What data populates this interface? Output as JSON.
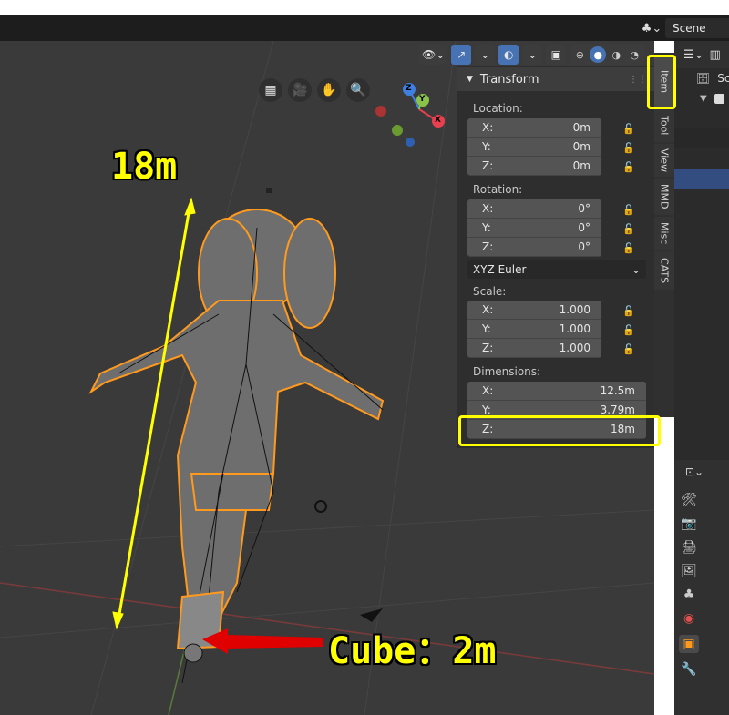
{
  "header": {
    "scene_label": "Scene"
  },
  "panel": {
    "title": "Transform",
    "location": {
      "label": "Location:",
      "x": {
        "axis": "X:",
        "value": "0m"
      },
      "y": {
        "axis": "Y:",
        "value": "0m"
      },
      "z": {
        "axis": "Z:",
        "value": "0m"
      }
    },
    "rotation": {
      "label": "Rotation:",
      "x": {
        "axis": "X:",
        "value": "0°"
      },
      "y": {
        "axis": "Y:",
        "value": "0°"
      },
      "z": {
        "axis": "Z:",
        "value": "0°"
      }
    },
    "rotation_mode": "XYZ Euler",
    "scale": {
      "label": "Scale:",
      "x": {
        "axis": "X:",
        "value": "1.000"
      },
      "y": {
        "axis": "Y:",
        "value": "1.000"
      },
      "z": {
        "axis": "Z:",
        "value": "1.000"
      }
    },
    "dimensions": {
      "label": "Dimensions:",
      "x": {
        "axis": "X:",
        "value": "12.5m"
      },
      "y": {
        "axis": "Y:",
        "value": "3.79m"
      },
      "z": {
        "axis": "Z:",
        "value": "18m"
      }
    }
  },
  "tabs": [
    "Item",
    "Tool",
    "View",
    "MMD",
    "Misc",
    "CATS"
  ],
  "gizmo": {
    "x": "X",
    "y": "Y",
    "z": "Z"
  },
  "annotations": {
    "height_label": "18m",
    "cube_label": "Cube：2m"
  },
  "colors": {
    "highlight": "#ffff00",
    "arrow_red": "#e00000",
    "accent_blue": "#4772b3",
    "axis_x": "#e8404f",
    "axis_y": "#8bc34a",
    "axis_z": "#3f7fe0"
  },
  "outliner": {
    "item": "Sc"
  }
}
